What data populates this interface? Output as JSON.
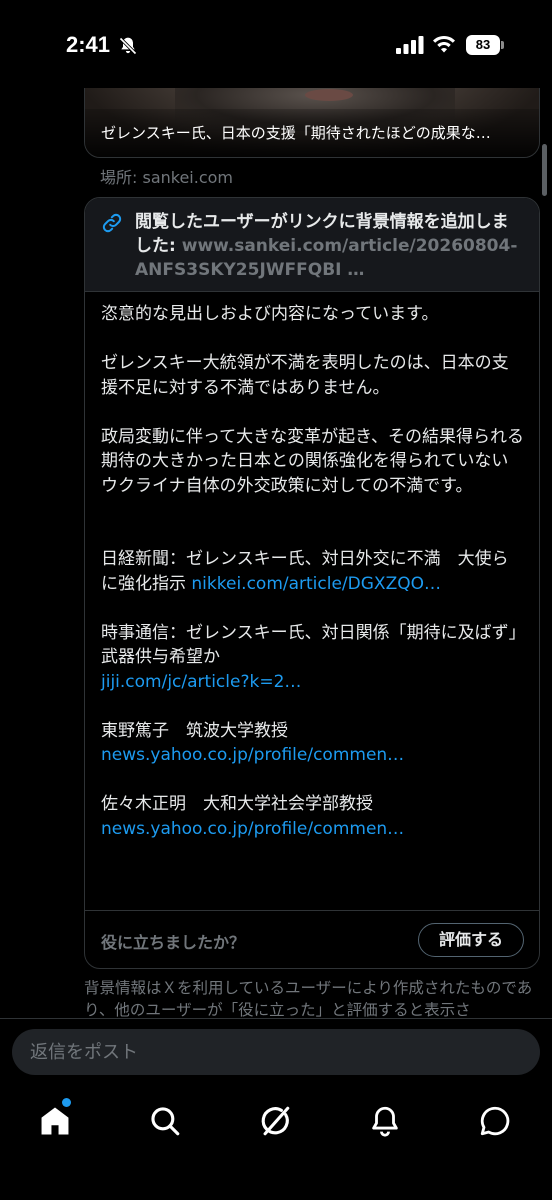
{
  "status_bar": {
    "time": "2:41",
    "battery": "83"
  },
  "media": {
    "caption": "ゼレンスキー氏、日本の支援「期待されたほどの成果な…"
  },
  "location": "場所: sankei.com",
  "note": {
    "title": "閲覧したユーザーがリンクに背景情報を追加しました:",
    "url": "www.sankei.com/article/20260804-ANFS3SKY25JWFFQBI …",
    "paragraphs": [
      "恣意的な見出しおよび内容になっています。",
      "ゼレンスキー大統領が不満を表明したのは、日本の支援不足に対する不満ではありません。",
      "政局変動に伴って大きな変革が起き、その結果得られる期待の大きかった日本との関係強化を得られていないウクライナ自体の外交政策に対しての不満です。"
    ],
    "sources": [
      {
        "text": "日経新聞：ゼレンスキー氏、対日外交に不満　大使らに強化指示 ",
        "link": "nikkei.com/article/DGXZQO…"
      },
      {
        "text": "時事通信：ゼレンスキー氏、対日関係「期待に及ばず」　武器供与希望か",
        "link": "jiji.com/jc/article?k=2…"
      },
      {
        "text": "東野篤子　筑波大学教授",
        "link": "news.yahoo.co.jp/profile/commen…"
      },
      {
        "text": "佐々木正明　大和大学社会学部教授",
        "link": "news.yahoo.co.jp/profile/commen…"
      }
    ],
    "helpful_question": "役に立ちましたか？",
    "rate_label": "評価する"
  },
  "disclaimer": "背景情報はＸを利用しているユーザーにより作成されたものであり、他のユーザーが「役に立った」と評価すると表示さ",
  "reply": {
    "placeholder": "返信をポスト"
  },
  "nav": {
    "items": [
      "home-icon",
      "search-icon",
      "grok-icon",
      "bell-icon",
      "chat-icon"
    ],
    "accent": "#1d9bf0"
  }
}
